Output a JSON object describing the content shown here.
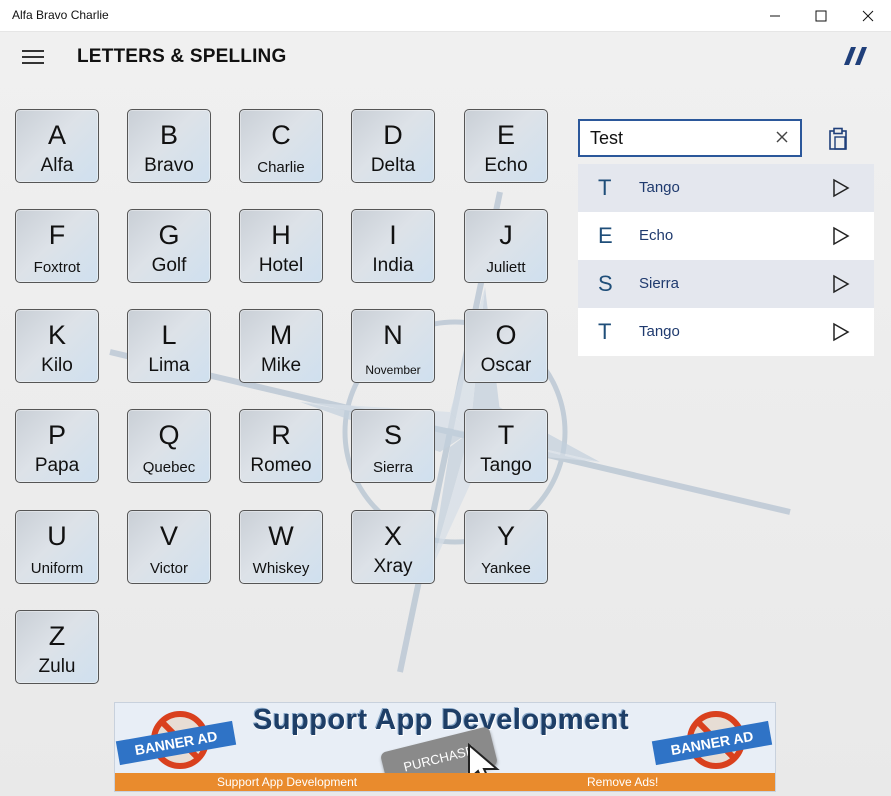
{
  "window": {
    "title": "Alfa Bravo Charlie",
    "min": "—",
    "max": "☐",
    "close": "✕"
  },
  "header": {
    "title": "LETTERS & SPELLING",
    "logo": "//"
  },
  "letters": [
    {
      "l": "A",
      "w": "Alfa"
    },
    {
      "l": "B",
      "w": "Bravo"
    },
    {
      "l": "C",
      "w": "Charlie"
    },
    {
      "l": "D",
      "w": "Delta"
    },
    {
      "l": "E",
      "w": "Echo"
    },
    {
      "l": "F",
      "w": "Foxtrot"
    },
    {
      "l": "G",
      "w": "Golf"
    },
    {
      "l": "H",
      "w": "Hotel"
    },
    {
      "l": "I",
      "w": "India"
    },
    {
      "l": "J",
      "w": "Juliett"
    },
    {
      "l": "K",
      "w": "Kilo"
    },
    {
      "l": "L",
      "w": "Lima"
    },
    {
      "l": "M",
      "w": "Mike"
    },
    {
      "l": "N",
      "w": "November"
    },
    {
      "l": "O",
      "w": "Oscar"
    },
    {
      "l": "P",
      "w": "Papa"
    },
    {
      "l": "Q",
      "w": "Quebec"
    },
    {
      "l": "R",
      "w": "Romeo"
    },
    {
      "l": "S",
      "w": "Sierra"
    },
    {
      "l": "T",
      "w": "Tango"
    },
    {
      "l": "U",
      "w": "Uniform"
    },
    {
      "l": "V",
      "w": "Victor"
    },
    {
      "l": "W",
      "w": "Whiskey"
    },
    {
      "l": "X",
      "w": "Xray"
    },
    {
      "l": "Y",
      "w": "Yankee"
    },
    {
      "l": "Z",
      "w": "Zulu"
    }
  ],
  "search": {
    "value": "Test",
    "clear_icon": "close-icon",
    "paste_icon": "clipboard-icon"
  },
  "results": [
    {
      "l": "T",
      "w": "Tango"
    },
    {
      "l": "E",
      "w": "Echo"
    },
    {
      "l": "S",
      "w": "Sierra"
    },
    {
      "l": "T",
      "w": "Tango"
    }
  ],
  "banner": {
    "headline": "Support App Development",
    "badge_left": "BANNER AD",
    "badge_right": "BANNER AD",
    "purchase": "PURCHASE",
    "footer_left": "Support App Development",
    "footer_right": "Remove Ads!"
  },
  "colors": {
    "accent": "#2b579a",
    "result_text": "#1f4e79",
    "alt_row": "#e4e7ee",
    "banner_orange": "#e98b2d"
  }
}
